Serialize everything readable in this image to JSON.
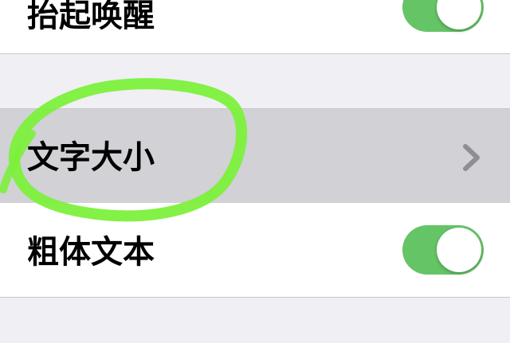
{
  "settings": {
    "rows": [
      {
        "label": "抬起唤醒",
        "toggle_on": true
      },
      {
        "label": "文字大小",
        "has_chevron": true,
        "highlighted": true
      },
      {
        "label": "粗体文本",
        "toggle_on": true
      }
    ]
  },
  "colors": {
    "toggle_on": "#65c466",
    "background": "#efeff4",
    "highlight": "#d1d1d6",
    "annotation_circle": "#7cf03c",
    "chevron": "#8e8e93"
  },
  "icons": {
    "disclosure": "chevron-right-icon",
    "annotation": "highlight-circle-annotation"
  }
}
